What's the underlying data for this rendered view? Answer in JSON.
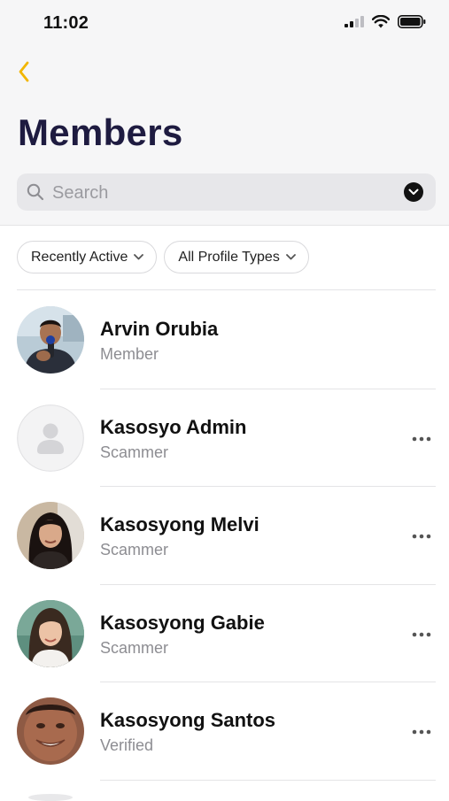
{
  "status_bar": {
    "time": "11:02",
    "icons": [
      "cellular-signal-icon",
      "wifi-icon",
      "battery-icon"
    ]
  },
  "header": {
    "back_icon": "chevron-left-icon",
    "title": "Members",
    "accent_color": "#f2b600",
    "title_color": "#1e1b40"
  },
  "search": {
    "placeholder": "Search",
    "value": "",
    "icon": "search-icon",
    "filter_icon": "chevron-down-circle-icon"
  },
  "filters": [
    {
      "label": "Recently Active",
      "icon": "chevron-down-icon"
    },
    {
      "label": "All Profile Types",
      "icon": "chevron-down-icon"
    }
  ],
  "members": [
    {
      "name": "Arvin Orubia",
      "type": "Member",
      "avatar": "photo",
      "has_more": false
    },
    {
      "name": "Kasosyo Admin",
      "type": "Scammer",
      "avatar": "placeholder-person-icon",
      "has_more": true
    },
    {
      "name": "Kasosyong Melvi",
      "type": "Scammer",
      "avatar": "photo",
      "has_more": true
    },
    {
      "name": "Kasosyong Gabie",
      "type": "Scammer",
      "avatar": "photo",
      "has_more": true
    },
    {
      "name": "Kasosyong Santos",
      "type": "Verified",
      "avatar": "photo",
      "has_more": true
    }
  ]
}
